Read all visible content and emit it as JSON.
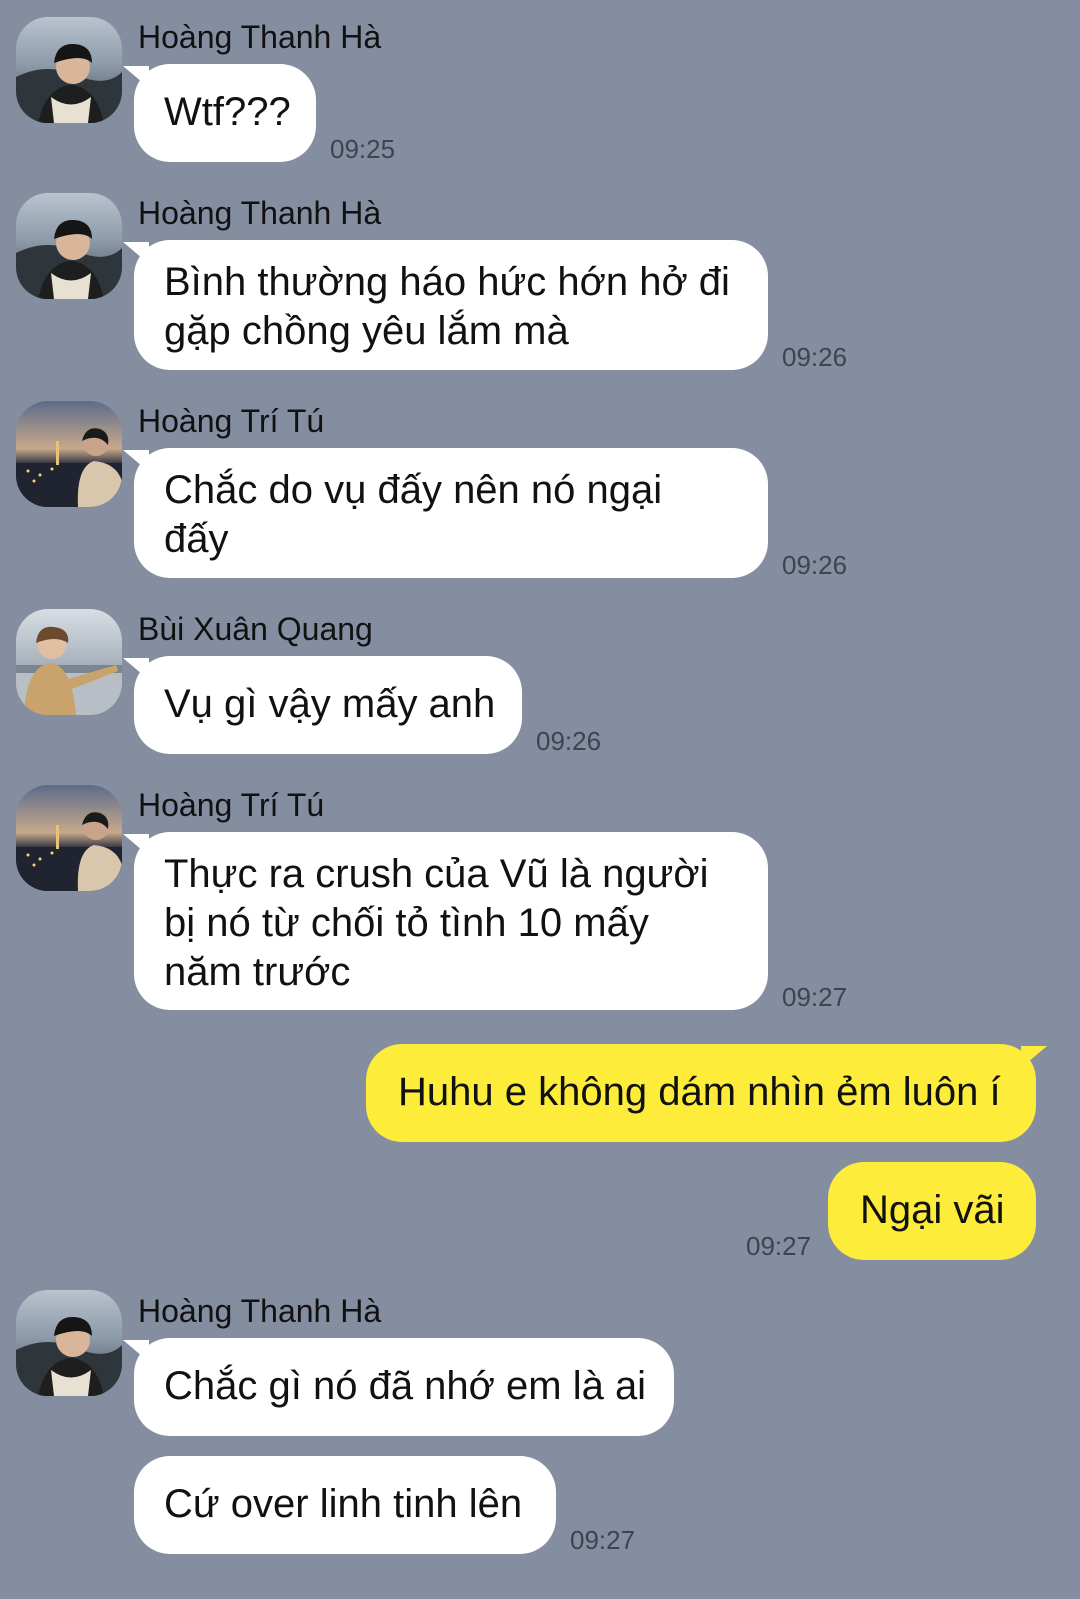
{
  "messages": [
    {
      "sender": "Hoàng Thanh Hà",
      "text": "Wtf???",
      "time": "09:25"
    },
    {
      "sender": "Hoàng Thanh Hà",
      "lines": [
        "Bình thường háo hức hớn hở đi",
        "gặp chồng yêu lắm mà"
      ],
      "time": "09:26"
    },
    {
      "sender": "Hoàng Trí Tú",
      "lines": [
        "Chắc do vụ đấy nên nó ngại",
        "đấy"
      ],
      "time": "09:26"
    },
    {
      "sender": "Bùi Xuân Quang",
      "text": "Vụ gì vậy mấy anh",
      "time": "09:26"
    },
    {
      "sender": "Hoàng Trí Tú",
      "lines": [
        "Thực ra crush của Vũ là người",
        "bị nó từ chối tỏ tình 10 mấy",
        "năm trước"
      ],
      "time": "09:27"
    },
    {
      "sender": "me",
      "text": "Huhu e không dám nhìn ẻm luôn í"
    },
    {
      "sender": "me",
      "text": "Ngại vãi",
      "time": "09:27"
    },
    {
      "sender": "Hoàng Thanh Hà",
      "text": "Chắc gì nó đã nhớ em là ai"
    },
    {
      "sender": "Hoàng Thanh Hà",
      "text": "Cứ over linh tinh lên",
      "time": "09:27"
    }
  ],
  "colors": {
    "background": "#848ea0",
    "incoming_bubble": "#ffffff",
    "outgoing_bubble": "#fdec3a"
  }
}
